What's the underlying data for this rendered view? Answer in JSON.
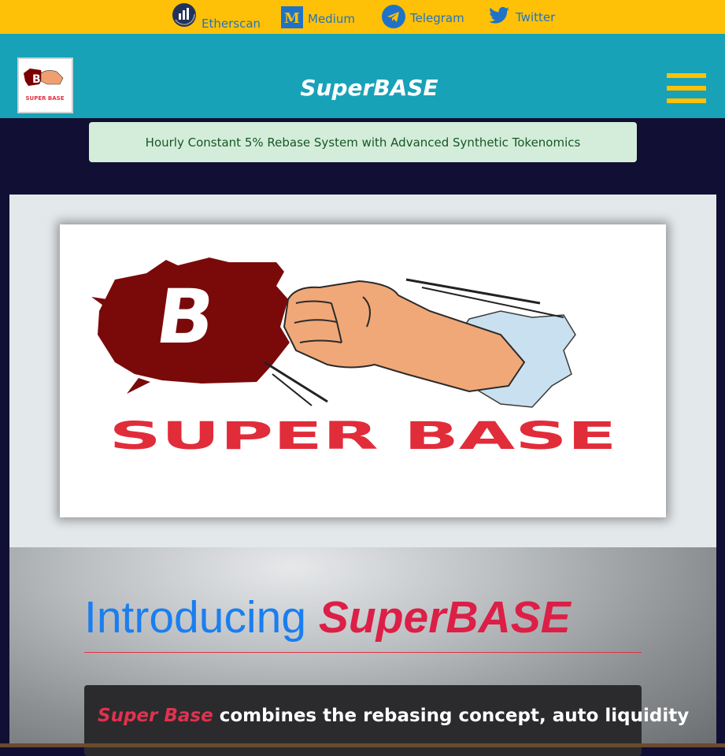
{
  "social": {
    "etherscan": "Etherscan",
    "medium": "Medium",
    "telegram": "Telegram",
    "twitter": "Twitter"
  },
  "navbar": {
    "brand": "SuperBASE",
    "logo_text": "SUPER BASE"
  },
  "alert": {
    "text": "Hourly Constant 5% Rebase System with Advanced Synthetic Tokenomics"
  },
  "hero": {
    "logo_letter": "B",
    "logo_text": "SUPER BASE"
  },
  "intro": {
    "heading_prefix": "Introducing",
    "heading_brand": "SuperBASE",
    "card_brand": "Super Base",
    "card_text": " combines the rebasing concept, auto liquidity"
  },
  "colors": {
    "topbar": "#ffc107",
    "navbar": "#17a2b8",
    "background": "#110f33",
    "alert_bg": "#d4edda",
    "accent_red": "#dc1f46",
    "accent_blue": "#1a7ef0"
  }
}
